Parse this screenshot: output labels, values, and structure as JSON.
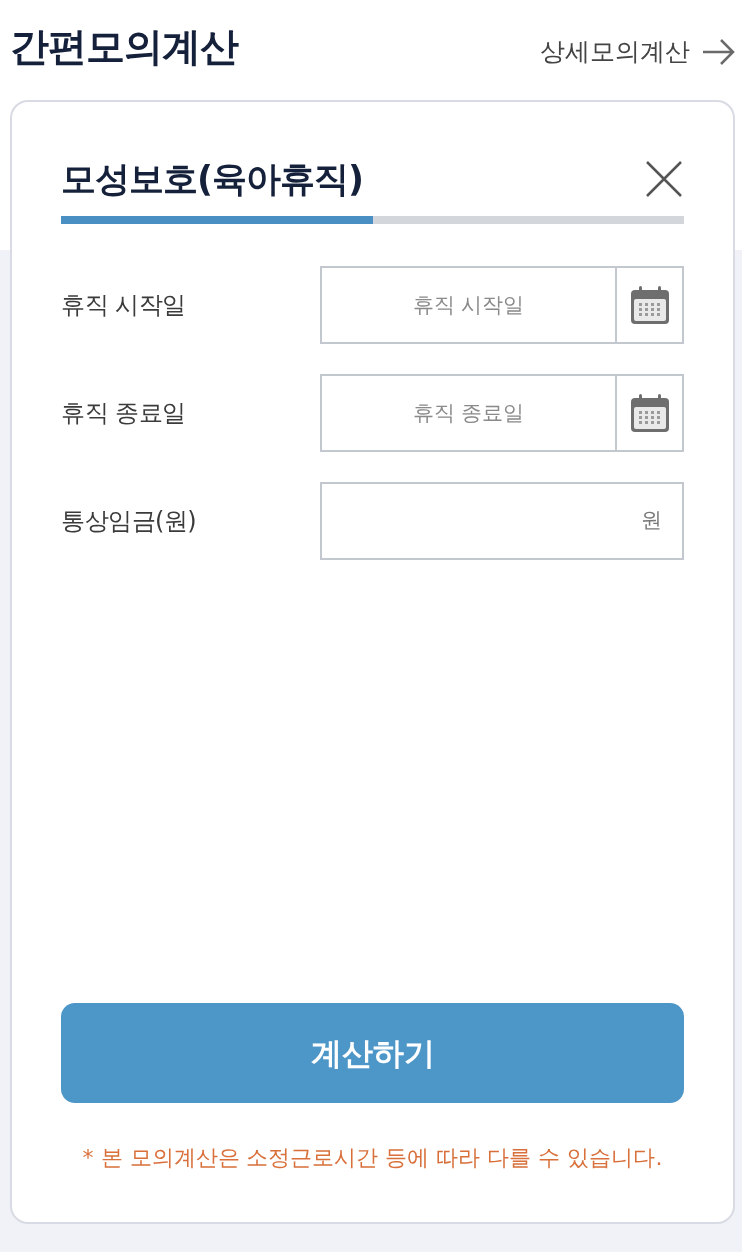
{
  "header": {
    "title": "간편모의계산",
    "detail_link": "상세모의계산"
  },
  "card": {
    "title": "모성보호(육아휴직)",
    "progress": {
      "level": 0.5
    },
    "fields": [
      {
        "kind": "date",
        "label": "휴직 시작일",
        "placeholder": "휴직 시작일"
      },
      {
        "kind": "date",
        "label": "휴직 종료일",
        "placeholder": "휴직 종료일"
      },
      {
        "kind": "amount",
        "label": "통상임금(원)",
        "unit": "원"
      }
    ],
    "submit_button": "계산하기",
    "note": "* 본 모의계산은 소정근로시간 등에 따라 다를 수 있습니다."
  }
}
